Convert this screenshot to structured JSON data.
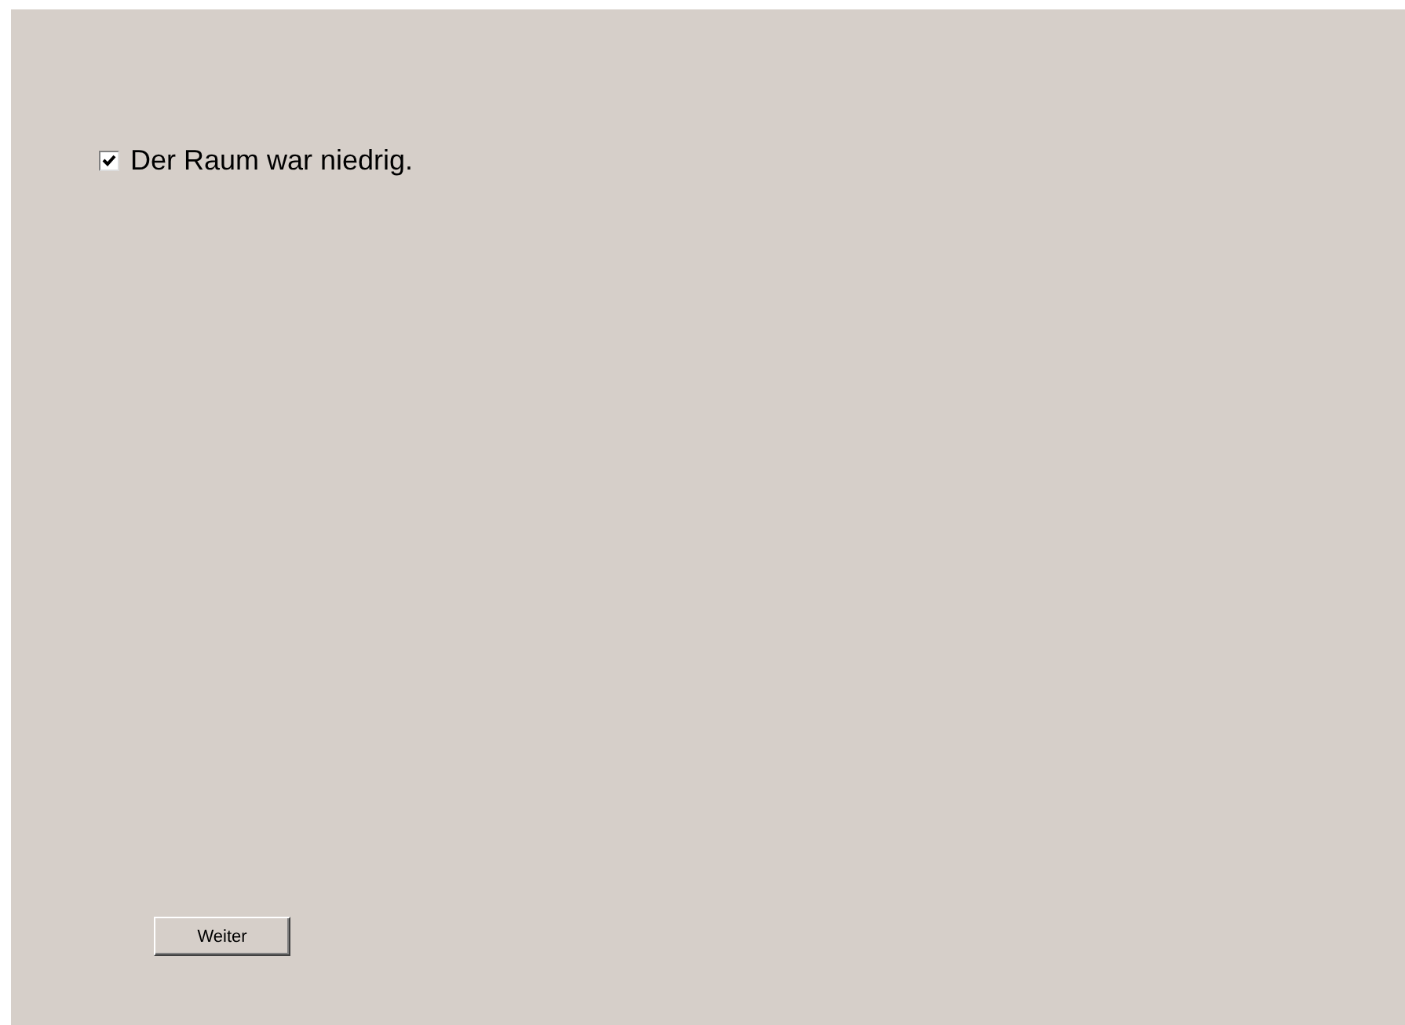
{
  "checkbox": {
    "label": "Der Raum war niedrig.",
    "checked": true
  },
  "button": "Weiter"
}
